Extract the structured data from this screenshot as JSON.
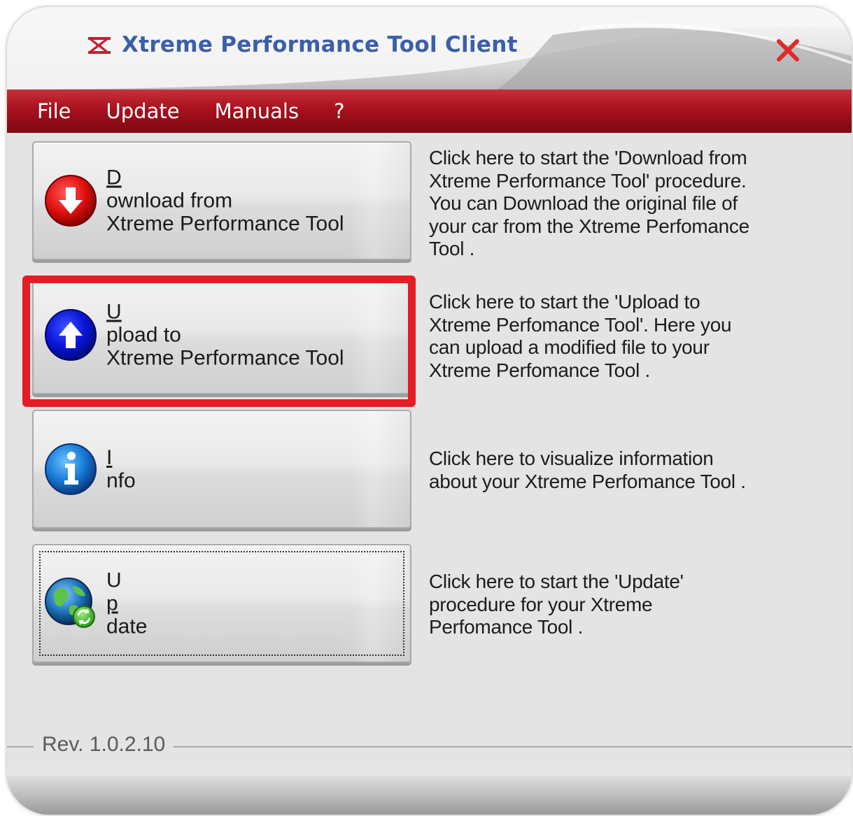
{
  "window": {
    "title": "Xtreme Performance Tool Client",
    "title_color": "#3b5fa8",
    "accent": "#a8111d"
  },
  "menu": {
    "items": [
      {
        "label": "File"
      },
      {
        "label": "Update"
      },
      {
        "label": "Manuals"
      },
      {
        "label": "?"
      }
    ]
  },
  "actions": [
    {
      "label_underlined": "D",
      "label_rest": "ownload from",
      "label_line2": "Xtreme Performance Tool",
      "icon": "download-arrow-icon",
      "description": "Click here to start the 'Download from\nXtreme Performance Tool' procedure.\nYou can Download the original file of\nyour car from the Xtreme Perfomance\nTool ."
    },
    {
      "label_underlined": "U",
      "label_rest": "pload to",
      "label_line2": "Xtreme Performance Tool",
      "icon": "upload-arrow-icon",
      "description": "Click here to start the 'Upload to\nXtreme Perfomance Tool'. Here you\ncan upload a modified file to your\nXtreme Perfomance Tool ."
    },
    {
      "label_underlined": "I",
      "label_rest": "nfo",
      "icon": "info-icon",
      "description": "Click here to visualize information\nabout your Xtreme Perfomance Tool ."
    },
    {
      "label_prefix": "U",
      "label_underlined": "p",
      "label_rest": "date",
      "icon": "globe-update-icon",
      "description": "Click here to start the 'Update'\n procedure for your Xtreme\nPerfomance Tool ."
    }
  ],
  "highlight": {
    "color": "#e51c23",
    "target": "upload-button"
  },
  "footer": {
    "revision": "Rev. 1.0.2.10"
  }
}
